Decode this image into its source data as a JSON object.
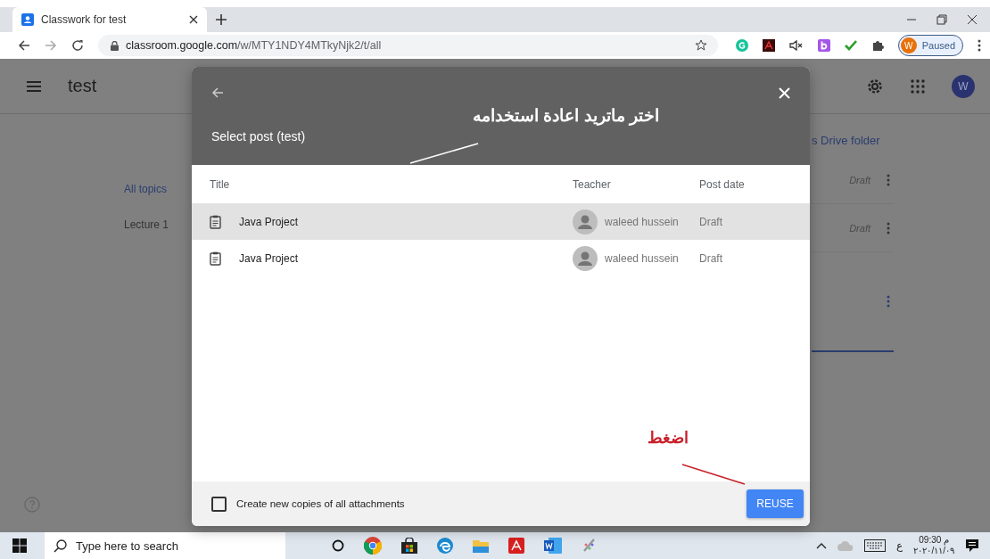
{
  "browser": {
    "tab_title": "Classwork for test",
    "url_host": "classroom.google.com",
    "url_path": "/w/MTY1NDY4MTkyNjk2/t/all",
    "profile_initial": "W",
    "profile_status": "Paused"
  },
  "page": {
    "course_title": "test",
    "avatar_initial": "W",
    "topics": [
      {
        "label": "All topics",
        "selected": true
      },
      {
        "label": "Lecture 1",
        "selected": false
      }
    ],
    "drive_link": "s Drive folder",
    "posts": [
      {
        "status": "Draft"
      },
      {
        "status": "Draft"
      }
    ]
  },
  "dialog": {
    "title": "Select post (test)",
    "columns": [
      "Title",
      "Teacher",
      "Post date"
    ],
    "rows": [
      {
        "title": "Java Project",
        "teacher": "waleed hussein",
        "date": "Draft",
        "selected": true
      },
      {
        "title": "Java Project",
        "teacher": "waleed hussein",
        "date": "Draft",
        "selected": false
      }
    ],
    "option": {
      "label": "Create new copies of all attachments",
      "checked": false
    },
    "button": "REUSE"
  },
  "annotations": [
    {
      "text": "اختر ماتريد اعادة استخدامه",
      "color": "#ffffff",
      "kind": "top"
    },
    {
      "text": "اضغط",
      "color": "#c8202a",
      "kind": "bottom"
    }
  ],
  "taskbar": {
    "search_placeholder": "Type here to search",
    "language": "ع",
    "time": "09:30 م",
    "date": "٢٠٢٠/١١/٠٩"
  }
}
